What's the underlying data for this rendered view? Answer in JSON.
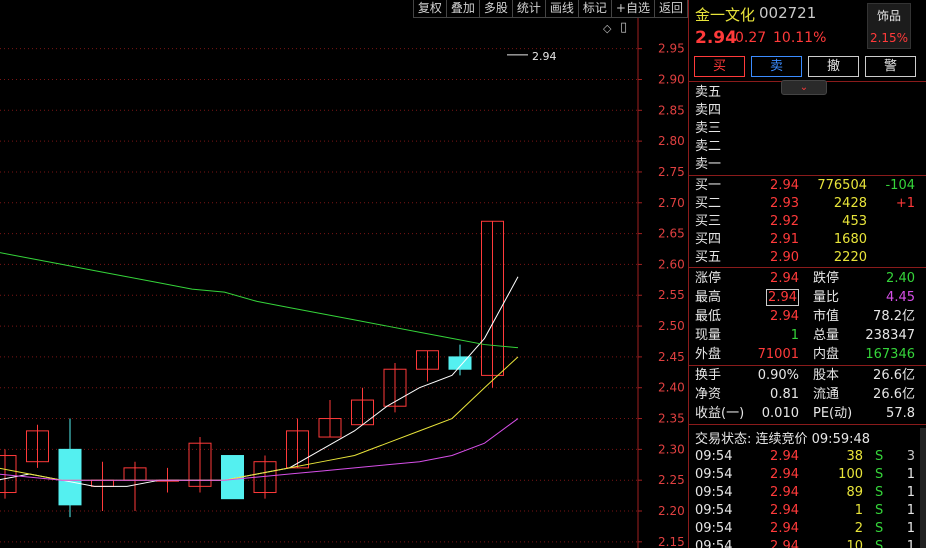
{
  "toolbar": [
    "复权",
    "叠加",
    "多股",
    "统计",
    "画线",
    "标记",
    "+自选",
    "返回"
  ],
  "chart_controls": {
    "diamond": "◇",
    "window": "▯"
  },
  "chart_data": {
    "type": "candlestick",
    "yticks": [
      "2.95",
      "2.90",
      "2.85",
      "2.80",
      "2.75",
      "2.70",
      "2.65",
      "2.60",
      "2.55",
      "2.50",
      "2.45",
      "2.40",
      "2.35",
      "2.30",
      "2.25",
      "2.20",
      "2.15"
    ],
    "ylim": [
      2.14,
      2.99
    ],
    "price_marker": "2.94",
    "candles": [
      {
        "o": 2.23,
        "c": 2.29,
        "h": 2.3,
        "l": 2.22
      },
      {
        "o": 2.28,
        "c": 2.33,
        "h": 2.34,
        "l": 2.27
      },
      {
        "o": 2.3,
        "c": 2.21,
        "h": 2.35,
        "l": 2.19
      },
      {
        "o": 2.24,
        "c": 2.25,
        "h": 2.28,
        "l": 2.2
      },
      {
        "o": 2.25,
        "c": 2.27,
        "h": 2.28,
        "l": 2.2
      },
      {
        "o": 2.25,
        "c": 2.25,
        "h": 2.27,
        "l": 2.23
      },
      {
        "o": 2.24,
        "c": 2.31,
        "h": 2.32,
        "l": 2.23
      },
      {
        "o": 2.29,
        "c": 2.22,
        "h": 2.29,
        "l": 2.22
      },
      {
        "o": 2.23,
        "c": 2.28,
        "h": 2.29,
        "l": 2.22
      },
      {
        "o": 2.27,
        "c": 2.33,
        "h": 2.35,
        "l": 2.27
      },
      {
        "o": 2.32,
        "c": 2.35,
        "h": 2.38,
        "l": 2.32
      },
      {
        "o": 2.34,
        "c": 2.38,
        "h": 2.4,
        "l": 2.34
      },
      {
        "o": 2.37,
        "c": 2.43,
        "h": 2.44,
        "l": 2.36
      },
      {
        "o": 2.43,
        "c": 2.46,
        "h": 2.46,
        "l": 2.41
      },
      {
        "o": 2.45,
        "c": 2.43,
        "h": 2.47,
        "l": 2.42
      },
      {
        "o": 2.42,
        "c": 2.67,
        "h": 2.67,
        "l": 2.4
      }
    ],
    "ma_lines": [
      {
        "color": "#ffffff",
        "values": [
          2.25,
          2.26,
          2.25,
          2.24,
          2.24,
          2.25,
          2.25,
          2.25,
          2.26,
          2.27,
          2.3,
          2.33,
          2.37,
          2.4,
          2.42,
          2.48,
          2.58
        ]
      },
      {
        "color": "#e8e43a",
        "values": [
          2.27,
          2.26,
          2.25,
          2.25,
          2.25,
          2.25,
          2.25,
          2.25,
          2.26,
          2.27,
          2.28,
          2.29,
          2.31,
          2.33,
          2.35,
          2.4,
          2.45
        ]
      },
      {
        "color": "#d64fe8",
        "values": [
          2.26,
          2.255,
          2.25,
          2.25,
          2.25,
          2.25,
          2.25,
          2.25,
          2.255,
          2.26,
          2.265,
          2.27,
          2.275,
          2.28,
          2.29,
          2.31,
          2.35
        ]
      },
      {
        "color": "#35d43a",
        "values": [
          2.62,
          2.61,
          2.6,
          2.59,
          2.58,
          2.57,
          2.56,
          2.555,
          2.54,
          2.53,
          2.52,
          2.51,
          2.5,
          2.49,
          2.48,
          2.47,
          2.465,
          2.465
        ]
      }
    ]
  },
  "quote": {
    "name": "金一文化",
    "code": "002721",
    "industry": "饰品",
    "industry_pct": "2.15%",
    "price": "2.94",
    "change": "0.27",
    "pct": "10.11%"
  },
  "actions": {
    "buy": "买",
    "sell": "卖",
    "cancel": "撤",
    "alert": "警"
  },
  "expand_icon": "⌄",
  "sells": [
    {
      "label": "卖五"
    },
    {
      "label": "卖四"
    },
    {
      "label": "卖三"
    },
    {
      "label": "卖二"
    },
    {
      "label": "卖一"
    }
  ],
  "buys": [
    {
      "label": "买一",
      "price": "2.94",
      "vol": "776504",
      "chg": "-104"
    },
    {
      "label": "买二",
      "price": "2.93",
      "vol": "2428",
      "chg": "+1"
    },
    {
      "label": "买三",
      "price": "2.92",
      "vol": "453",
      "chg": ""
    },
    {
      "label": "买四",
      "price": "2.91",
      "vol": "1680",
      "chg": ""
    },
    {
      "label": "买五",
      "price": "2.90",
      "vol": "2220",
      "chg": ""
    }
  ],
  "stats1": [
    {
      "l1": "涨停",
      "v1": "2.94",
      "l2": "跌停",
      "v2": "2.40"
    },
    {
      "l1": "最高",
      "v1": "2.94",
      "l2": "量比",
      "v2": "4.45"
    },
    {
      "l1": "最低",
      "v1": "2.94",
      "l2": "市值",
      "v2": "78.2亿"
    },
    {
      "l1": "现量",
      "v1": "1",
      "l2": "总量",
      "v2": "238347"
    },
    {
      "l1": "外盘",
      "v1": "71001",
      "l2": "内盘",
      "v2": "167346"
    }
  ],
  "stats2": [
    {
      "l1": "换手",
      "v1": "0.90%",
      "l2": "股本",
      "v2": "26.6亿"
    },
    {
      "l1": "净资",
      "v1": "0.81",
      "l2": "流通",
      "v2": "26.6亿"
    },
    {
      "l1": "收益(一)",
      "v1": "0.010",
      "l2": "PE(动)",
      "v2": "57.8"
    }
  ],
  "trade_status": "交易状态: 连续竞价 09:59:48",
  "ticks": [
    {
      "t": "09:54",
      "p": "2.94",
      "v": "38",
      "s": "S",
      "n": "3"
    },
    {
      "t": "09:54",
      "p": "2.94",
      "v": "100",
      "s": "S",
      "n": "1"
    },
    {
      "t": "09:54",
      "p": "2.94",
      "v": "89",
      "s": "S",
      "n": "1"
    },
    {
      "t": "09:54",
      "p": "2.94",
      "v": "1",
      "s": "S",
      "n": "1"
    },
    {
      "t": "09:54",
      "p": "2.94",
      "v": "2",
      "s": "S",
      "n": "1"
    },
    {
      "t": "09:54",
      "p": "2.94",
      "v": "10",
      "s": "S",
      "n": "1"
    }
  ]
}
